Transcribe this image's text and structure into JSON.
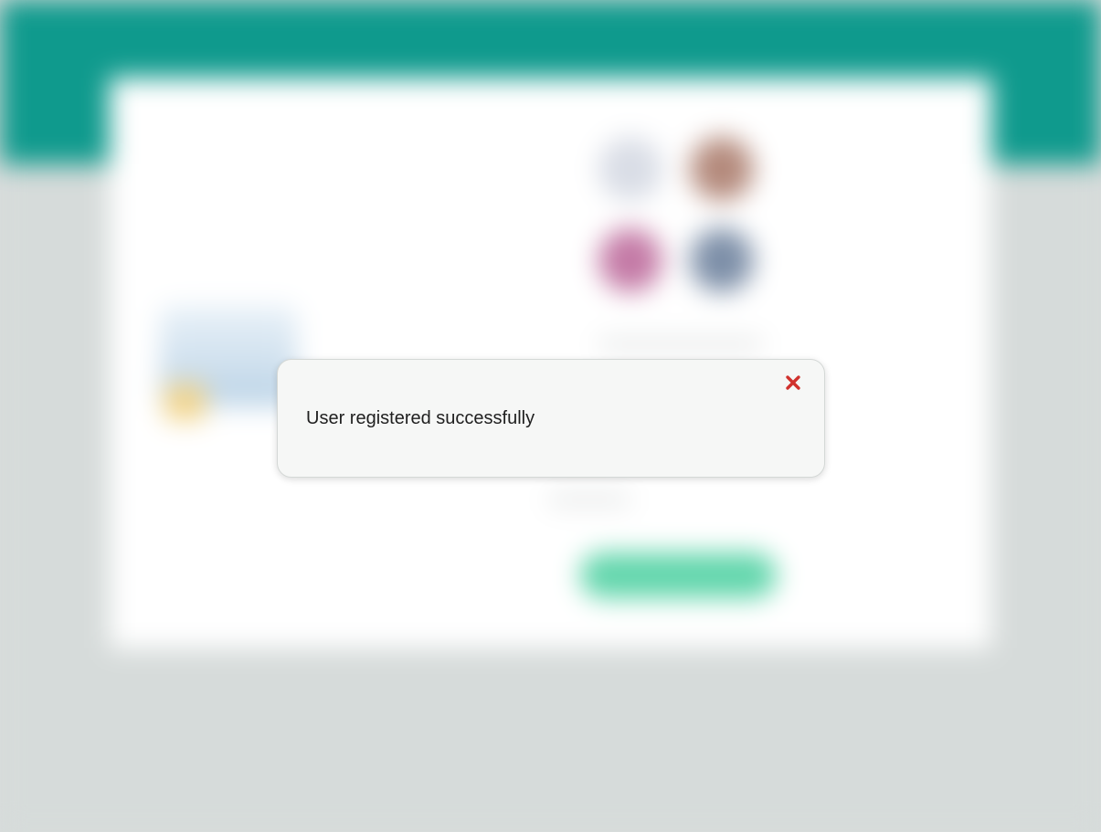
{
  "notification": {
    "message": "User registered successfully",
    "close_icon": "close-icon",
    "close_color": "#d0312d"
  },
  "colors": {
    "header": "#0f9a8d",
    "background": "#d6dbda",
    "card": "#ffffff",
    "primary_button": "#62d6ac"
  }
}
